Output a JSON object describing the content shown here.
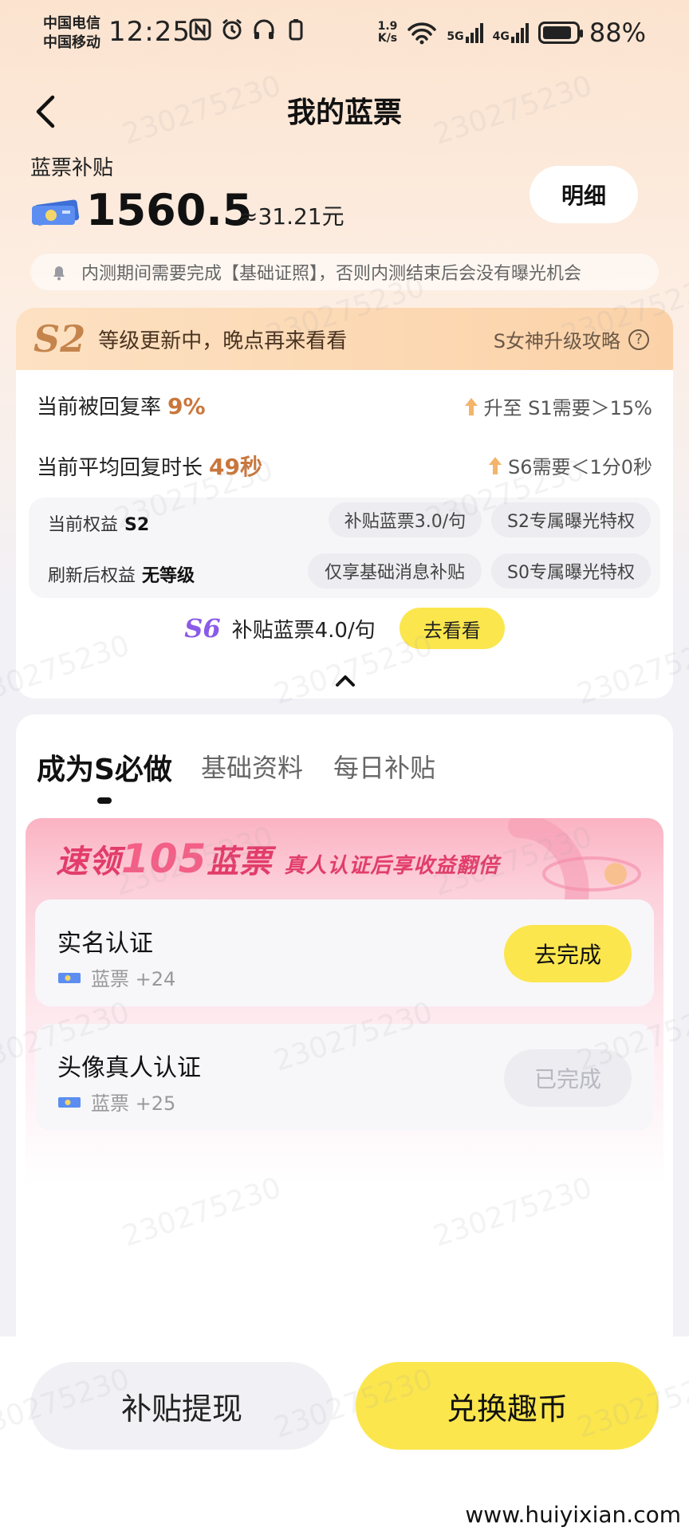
{
  "status_bar": {
    "carrier_1": "中国电信",
    "carrier_2": "中国移动",
    "time": "12:25",
    "net_speed_value": "1.9",
    "net_speed_unit": "K/s",
    "sig1": "5G",
    "sig2": "4G",
    "battery": "88%"
  },
  "header": {
    "title": "我的蓝票"
  },
  "balance": {
    "label": "蓝票补贴",
    "amount": "1560.5",
    "approx": "≈31.21元",
    "detail_button": "明细"
  },
  "notice": "内测期间需要完成【基础证照】，否则内测结束后会没有曝光机会",
  "level": {
    "badge": "S2",
    "message": "等级更新中，晚点再来看看",
    "guide": "S女神升级攻略",
    "reply_rate_label": "当前被回复率",
    "reply_rate_value": "9%",
    "reply_rate_target": "升至 S1需要＞15%",
    "reply_time_label": "当前平均回复时长",
    "reply_time_value": "49秒",
    "reply_time_target": "S6需要＜1分0秒",
    "current_rights_label": "当前权益",
    "current_rights_level": "S2",
    "current_chip_1": "补贴蓝票3.0/句",
    "current_chip_2": "S2专属曝光特权",
    "refresh_rights_label": "刷新后权益",
    "refresh_rights_level": "无等级",
    "refresh_chip_1": "仅享基础消息补贴",
    "refresh_chip_2": "S0专属曝光特权",
    "next_badge": "S6",
    "next_text": "补贴蓝票4.0/句",
    "go_look": "去看看"
  },
  "tabs": [
    {
      "label": "成为S必做"
    },
    {
      "label": "基础资料"
    },
    {
      "label": "每日补贴"
    }
  ],
  "promo": {
    "prefix": "速领",
    "number": "105",
    "unit": "蓝票",
    "subtitle": "真人认证后享收益翻倍"
  },
  "tasks": [
    {
      "title": "实名认证",
      "reward": "蓝票 +24",
      "button": "去完成"
    },
    {
      "title": "头像真人认证",
      "reward": "蓝票 +25",
      "button": "已完成"
    }
  ],
  "bottom": {
    "withdraw": "补贴提现",
    "exchange": "兑换趣币"
  },
  "watermark": "230275230",
  "site": "www.huiyixian.com",
  "colors": {
    "accent_yellow": "#fbe64e",
    "level_orange": "#c9773c",
    "promo_pink": "#e23d6a",
    "s6_purple": "#8a5ae8"
  }
}
